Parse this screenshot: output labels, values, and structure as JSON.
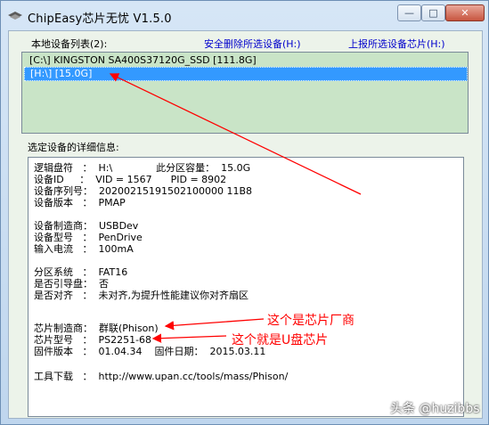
{
  "window": {
    "title": "ChipEasy芯片无忧 V1.5.0"
  },
  "controls": {
    "minimize_glyph": "—",
    "maximize_glyph": "□",
    "close_glyph": "✕"
  },
  "device_list": {
    "label": "本地设备列表(2):",
    "safe_remove_link": "安全删除所选设备(H:)",
    "upload_link": "上报所选设备芯片(H:)",
    "items": [
      {
        "text": "[C:\\] KINGSTON SA400S37120G_SSD [111.8G]",
        "selected": false
      },
      {
        "text": "[H:\\]  [15.0G]",
        "selected": true
      }
    ]
  },
  "details": {
    "label": "选定设备的详细信息:",
    "lines": [
      "逻辑盘符   ：  H:\\              此分区容量：  15.0G",
      "设备ID     ：  VID = 1567      PID = 8902",
      "设备序列号：  20200215191502100000 11B8",
      "设备版本   ：  PMAP",
      "",
      "设备制造商：  USBDev",
      "设备型号   ：  PenDrive",
      "输入电流   ：  100mA",
      "",
      "分区系统   ：  FAT16",
      "是否引导盘：  否",
      "是否对齐   ：  未对齐,为提升性能建议你对齐扇区",
      "",
      "芯片制造商：  群联(Phison)",
      "芯片型号   ：  PS2251-68",
      "固件版本   ：  01.04.34    固件日期：  2015.03.11",
      "",
      "工具下载   ：  http://www.upan.cc/tools/mass/Phison/"
    ]
  },
  "annotations": {
    "manufacturer_note": "这个是芯片厂商",
    "model_note": "这个就是U盘芯片",
    "color": "#ff0000"
  },
  "watermark": "头条 @huzibbs",
  "icons": {
    "app": "chip-eye-icon"
  }
}
